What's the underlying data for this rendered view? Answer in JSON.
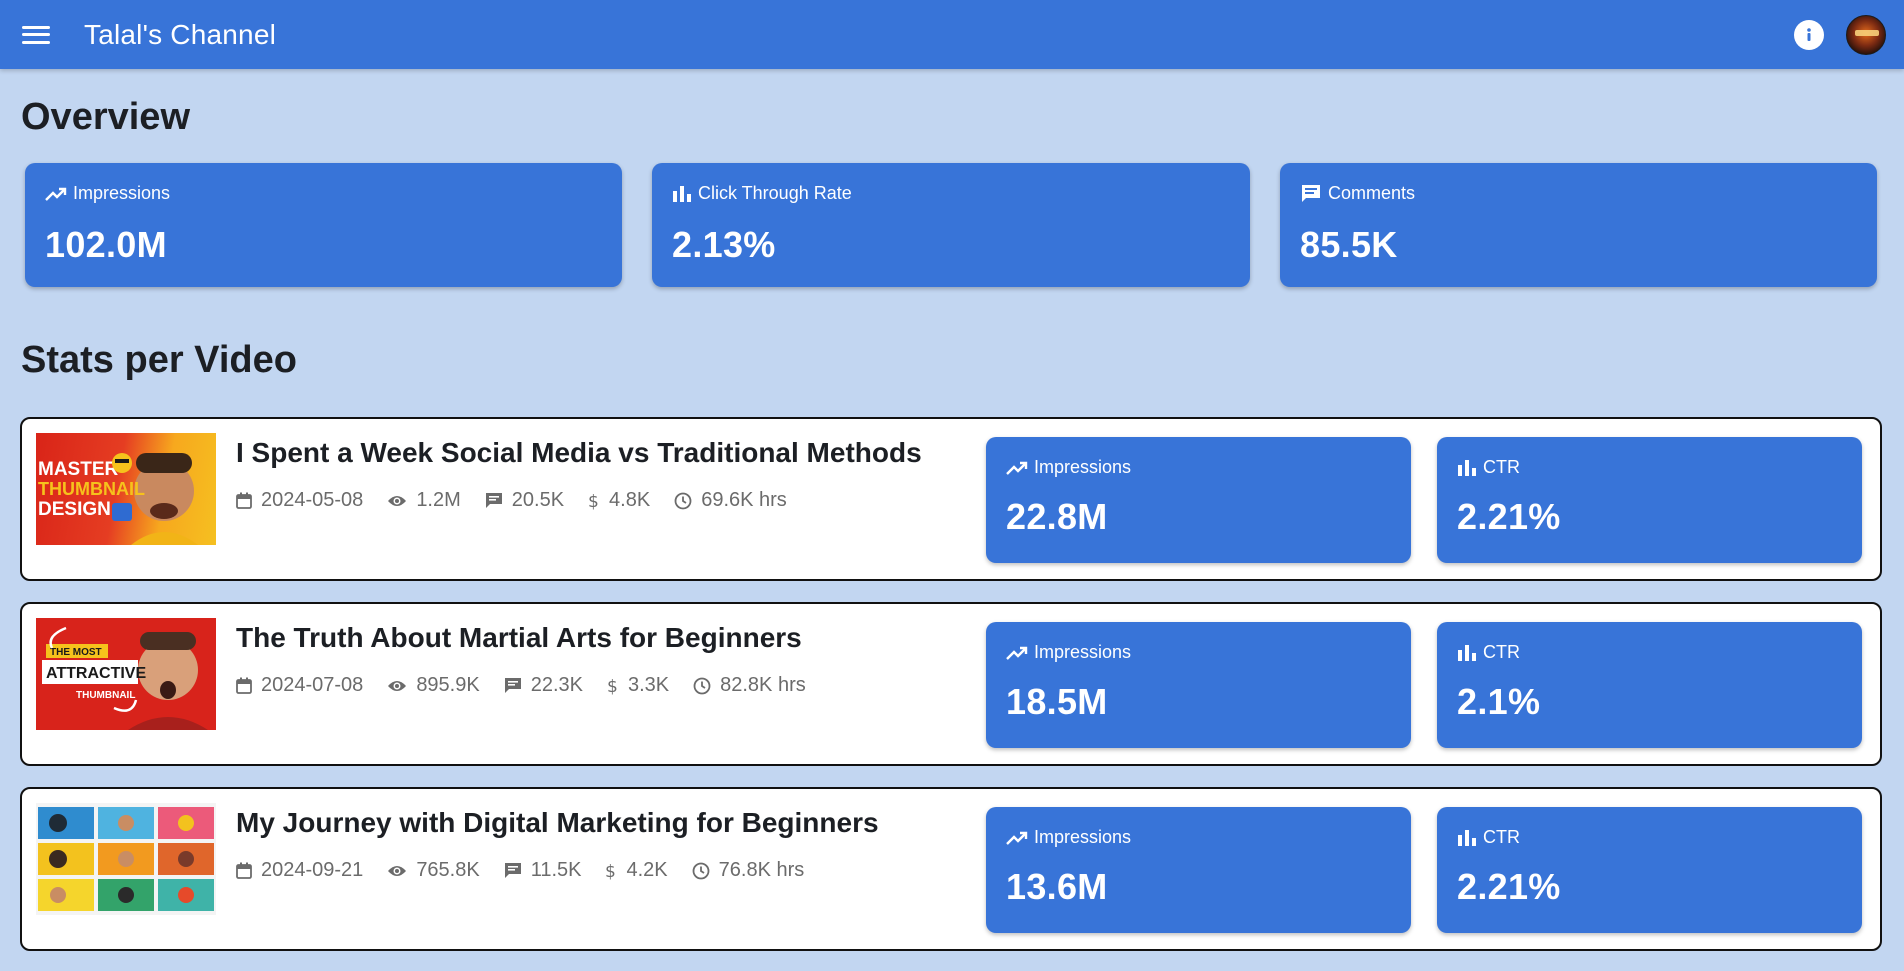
{
  "app": {
    "title": "Talal's Channel"
  },
  "icons": {
    "menu": "menu-icon",
    "info": "info-icon",
    "trending": "trending-up-icon",
    "bar_chart": "bar-chart-icon",
    "comment": "comment-icon",
    "calendar": "calendar-icon",
    "eye": "eye-icon",
    "dollar": "dollar-icon",
    "clock": "clock-icon"
  },
  "colors": {
    "primary": "#3874d8",
    "background": "#c2d6f1"
  },
  "overview": {
    "title": "Overview",
    "cards": [
      {
        "label": "Impressions",
        "value": "102.0M",
        "icon": "trending-up-icon"
      },
      {
        "label": "Click Through Rate",
        "value": "2.13%",
        "icon": "bar-chart-icon"
      },
      {
        "label": "Comments",
        "value": "85.5K",
        "icon": "comment-icon"
      }
    ]
  },
  "stats": {
    "title": "Stats per Video",
    "videos": [
      {
        "title": "I Spent a Week Social Media vs Traditional Methods",
        "date": "2024-05-08",
        "views": "1.2M",
        "comments": "20.5K",
        "revenue": "4.8K",
        "watch_time": "69.6K hrs",
        "impressions_label": "Impressions",
        "impressions": "22.8M",
        "ctr_label": "CTR",
        "ctr": "2.21%",
        "thumbnail_text": [
          "MASTER",
          "THUMBNAIL",
          "DESIGN"
        ]
      },
      {
        "title": "The Truth About Martial Arts for Beginners",
        "date": "2024-07-08",
        "views": "895.9K",
        "comments": "22.3K",
        "revenue": "3.3K",
        "watch_time": "82.8K hrs",
        "impressions_label": "Impressions",
        "impressions": "18.5M",
        "ctr_label": "CTR",
        "ctr": "2.1%",
        "thumbnail_text": [
          "THE MOST",
          "ATTRACTIVE",
          "THUMBNAIL"
        ]
      },
      {
        "title": "My Journey with Digital Marketing for Beginners",
        "date": "2024-09-21",
        "views": "765.8K",
        "comments": "11.5K",
        "revenue": "4.2K",
        "watch_time": "76.8K hrs",
        "impressions_label": "Impressions",
        "impressions": "13.6M",
        "ctr_label": "CTR",
        "ctr": "2.21%",
        "thumbnail_text": []
      }
    ]
  }
}
